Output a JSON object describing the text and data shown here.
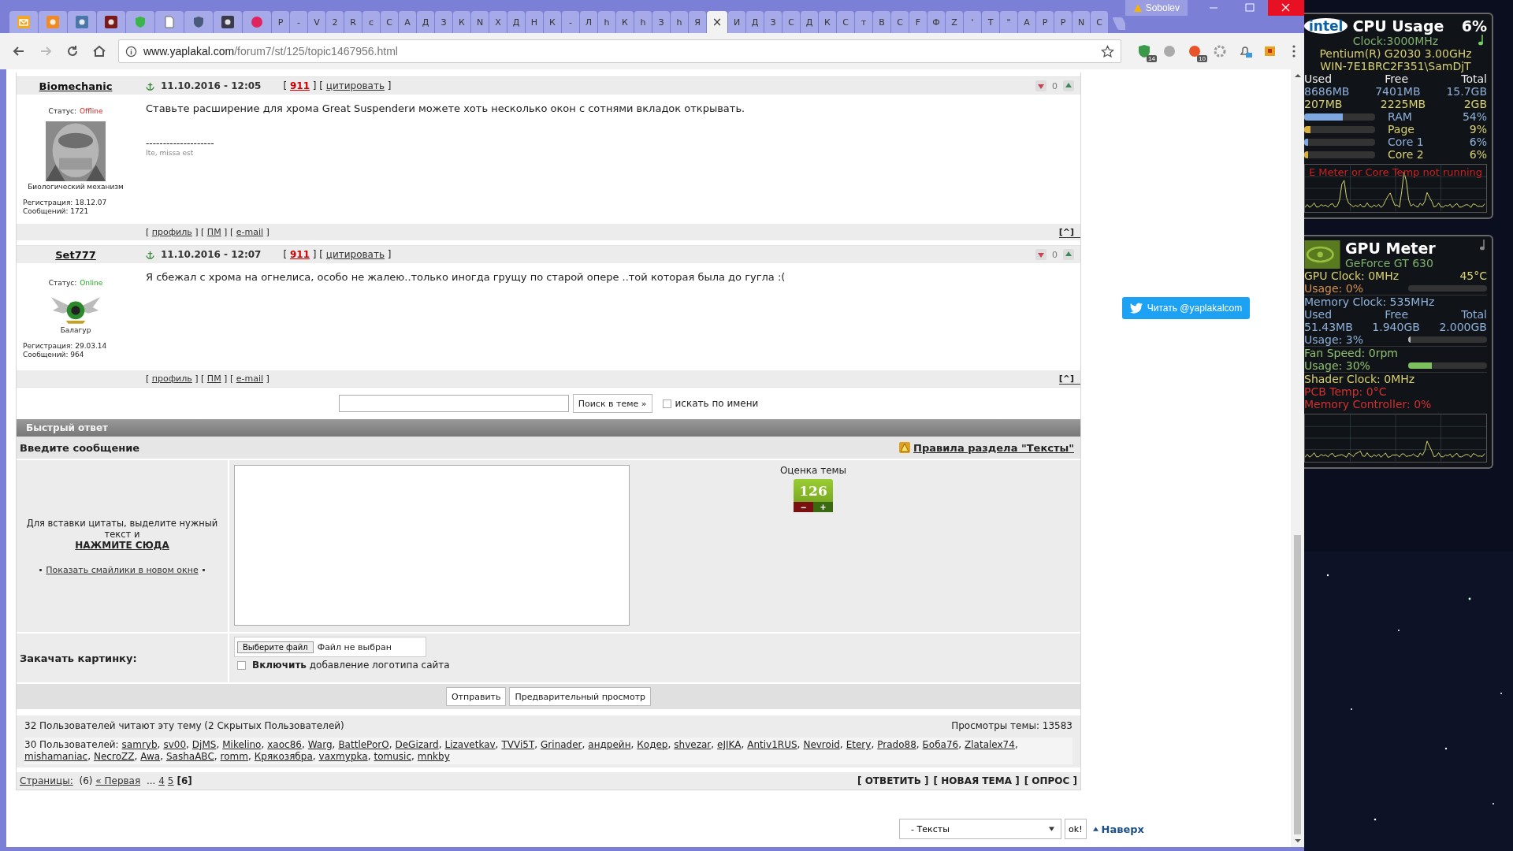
{
  "browser": {
    "profile": "Sobolev",
    "tabs": [
      {
        "kind": "favicon",
        "selected": false
      },
      {
        "kind": "favicon",
        "selected": false
      },
      {
        "kind": "favicon",
        "selected": false
      },
      {
        "kind": "favicon",
        "selected": false
      },
      {
        "kind": "favicon",
        "selected": false
      },
      {
        "kind": "favicon",
        "selected": false
      },
      {
        "kind": "favicon",
        "selected": false
      },
      {
        "kind": "favicon",
        "selected": false
      },
      {
        "kind": "favicon",
        "selected": false
      },
      {
        "kind": "letter",
        "label": "Р",
        "selected": false
      },
      {
        "kind": "letter",
        "label": "-",
        "selected": false
      },
      {
        "kind": "letter",
        "label": "V",
        "selected": false
      },
      {
        "kind": "letter",
        "label": "2",
        "selected": false
      },
      {
        "kind": "letter",
        "label": "R",
        "selected": false
      },
      {
        "kind": "letter",
        "label": "с",
        "selected": false
      },
      {
        "kind": "letter",
        "label": "С",
        "selected": false
      },
      {
        "kind": "letter",
        "label": "А",
        "selected": false
      },
      {
        "kind": "letter",
        "label": "Д",
        "selected": false
      },
      {
        "kind": "letter",
        "label": "З",
        "selected": false
      },
      {
        "kind": "letter",
        "label": "К",
        "selected": false
      },
      {
        "kind": "letter",
        "label": "N",
        "selected": false
      },
      {
        "kind": "letter",
        "label": "Х",
        "selected": false
      },
      {
        "kind": "letter",
        "label": "Д",
        "selected": false
      },
      {
        "kind": "letter",
        "label": "Н",
        "selected": false
      },
      {
        "kind": "letter",
        "label": "К",
        "selected": false
      },
      {
        "kind": "letter",
        "label": "-",
        "selected": false
      },
      {
        "kind": "letter",
        "label": "Л",
        "selected": false
      },
      {
        "kind": "letter",
        "label": "h",
        "selected": false
      },
      {
        "kind": "letter",
        "label": "К",
        "selected": false
      },
      {
        "kind": "letter",
        "label": "h",
        "selected": false
      },
      {
        "kind": "letter",
        "label": "З",
        "selected": false
      },
      {
        "kind": "letter",
        "label": "h",
        "selected": false
      },
      {
        "kind": "letter",
        "label": "Я",
        "selected": false
      },
      {
        "kind": "letter",
        "label": "×",
        "selected": true
      },
      {
        "kind": "letter",
        "label": "И",
        "selected": false
      },
      {
        "kind": "letter",
        "label": "Д",
        "selected": false
      },
      {
        "kind": "letter",
        "label": "З",
        "selected": false
      },
      {
        "kind": "letter",
        "label": "С",
        "selected": false
      },
      {
        "kind": "letter",
        "label": "Д",
        "selected": false
      },
      {
        "kind": "letter",
        "label": "К",
        "selected": false
      },
      {
        "kind": "letter",
        "label": "С",
        "selected": false
      },
      {
        "kind": "letter",
        "label": "т",
        "selected": false
      },
      {
        "kind": "letter",
        "label": "В",
        "selected": false
      },
      {
        "kind": "letter",
        "label": "С",
        "selected": false
      },
      {
        "kind": "letter",
        "label": "F",
        "selected": false
      },
      {
        "kind": "letter",
        "label": "Ф",
        "selected": false
      },
      {
        "kind": "letter",
        "label": "Z",
        "selected": false
      },
      {
        "kind": "letter",
        "label": "'",
        "selected": false
      },
      {
        "kind": "letter",
        "label": "Т",
        "selected": false
      },
      {
        "kind": "letter",
        "label": "\"",
        "selected": false
      },
      {
        "kind": "letter",
        "label": "А",
        "selected": false
      },
      {
        "kind": "letter",
        "label": "Р",
        "selected": false
      },
      {
        "kind": "letter",
        "label": "Р",
        "selected": false
      },
      {
        "kind": "letter",
        "label": "N",
        "selected": false
      },
      {
        "kind": "letter",
        "label": "С",
        "selected": false
      }
    ],
    "url_host": "www.yaplakal.com",
    "url_path": "/forum7/st/125/topic1467956.html",
    "badges": [
      "14",
      "10"
    ]
  },
  "posts": [
    {
      "author": "Biomechanic",
      "status_label": "Статус:",
      "status": "Offline",
      "online": false,
      "rank": "Биологический механизм",
      "registered": "Регистрация: 18.12.07",
      "messages": "Сообщений: 1721",
      "date": "11.10.2016 - 12:05",
      "votes": "0",
      "text": "Ставьте расширение для хрома Great Suspenderи можете хоть несколько окон с сотнями вкладок открывать.",
      "signature": [
        "--------------------",
        "Ite, missa est"
      ],
      "meta": [
        {
          "kind": "text",
          "text": "[ "
        },
        {
          "kind": "alert",
          "text": "911"
        },
        {
          "kind": "text",
          "text": " ] [ "
        },
        {
          "kind": "link",
          "text": "цитировать"
        },
        {
          "kind": "text",
          "text": " ]"
        }
      ],
      "footer": [
        {
          "kind": "text",
          "text": "[ "
        },
        {
          "kind": "link",
          "text": "профиль"
        },
        {
          "kind": "text",
          "text": " ] [ "
        },
        {
          "kind": "link",
          "text": "ПМ"
        },
        {
          "kind": "text",
          "text": " ] [ "
        },
        {
          "kind": "link",
          "text": "e-mail"
        },
        {
          "kind": "text",
          "text": " ]"
        }
      ],
      "top": "[^]"
    },
    {
      "author": "Set777",
      "status_label": "Статус:",
      "status": "Online",
      "online": true,
      "rank": "Балагур",
      "registered": "Регистрация: 29.03.14",
      "messages": "Сообщений: 964",
      "date": "11.10.2016 - 12:07",
      "votes": "0",
      "text": "Я сбежал с хрома на огнелиса, особо не жалею..только иногда грущу по старой опере ..той которая была до гугла :(",
      "meta": [
        {
          "kind": "text",
          "text": "[ "
        },
        {
          "kind": "alert",
          "text": "911"
        },
        {
          "kind": "text",
          "text": " ] [ "
        },
        {
          "kind": "link",
          "text": "цитировать"
        },
        {
          "kind": "text",
          "text": " ]"
        }
      ],
      "footer": [
        {
          "kind": "text",
          "text": "[ "
        },
        {
          "kind": "link",
          "text": "профиль"
        },
        {
          "kind": "text",
          "text": " ] [ "
        },
        {
          "kind": "link",
          "text": "ПМ"
        },
        {
          "kind": "text",
          "text": " ] [ "
        },
        {
          "kind": "link",
          "text": "e-mail"
        },
        {
          "kind": "text",
          "text": " ]"
        }
      ],
      "top": "[^]"
    }
  ],
  "search": {
    "button": "Поиск в теме »",
    "checkbox_label": "искать по имени",
    "checked": false
  },
  "quick_reply": {
    "title": "Быстрый ответ",
    "prompt": "Введите сообщение",
    "rules": "Правила раздела \"Тексты\"",
    "hint": "Для вставки цитаты, выделите нужный текст и",
    "hint_link": "НАЖМИТЕ СЮДА",
    "smileys": [
      {
        "kind": "text",
        "text": "• "
      },
      {
        "kind": "link",
        "text": "Показать смайлики в новом окне"
      },
      {
        "kind": "text",
        "text": " •"
      }
    ],
    "rating_label": "Оценка темы",
    "rating": "126",
    "minus": "−",
    "plus": "+",
    "upload_label": "Закачать картинку:",
    "file_button": "Выберите файл",
    "file_status": "Файл не выбран",
    "logo_checked": false,
    "logo_label": "**Включить** добавление логотипа сайта",
    "buttons": [
      "Отправить",
      "Предварительный просмотр"
    ]
  },
  "readers": {
    "summary": "32 Пользователей читают эту тему (2 Скрытых Пользователей)",
    "views": "Просмотры темы: 13583",
    "prefix": "30 Пользователей:",
    "users": [
      {
        "name": "samryb",
        "sep": ","
      },
      {
        "name": "sv00",
        "sep": ","
      },
      {
        "name": "DjMS",
        "sep": ","
      },
      {
        "name": "Mikelino",
        "sep": ","
      },
      {
        "name": "xaoc86",
        "sep": ","
      },
      {
        "name": "Warg",
        "sep": ","
      },
      {
        "name": "BattlePorO",
        "sep": ","
      },
      {
        "name": "DeGizard",
        "sep": ","
      },
      {
        "name": "Lizavetkav",
        "sep": ","
      },
      {
        "name": "TVVi5T",
        "sep": ","
      },
      {
        "name": "Grinader",
        "sep": ","
      },
      {
        "name": "андрейн",
        "sep": ","
      },
      {
        "name": "Кодер",
        "sep": ","
      },
      {
        "name": "shvezar",
        "sep": ","
      },
      {
        "name": "eJIKA",
        "sep": ","
      },
      {
        "name": "Antiv1RUS",
        "sep": ","
      },
      {
        "name": "Nevroid",
        "sep": ","
      },
      {
        "name": "Etery",
        "sep": ","
      },
      {
        "name": "Prado88",
        "sep": ","
      },
      {
        "name": "Боба76",
        "sep": ","
      },
      {
        "name": "Zlatalex74",
        "sep": ","
      },
      {
        "name": "mishamaniac",
        "sep": ","
      },
      {
        "name": "NecroZZ",
        "sep": ","
      },
      {
        "name": "Awa",
        "sep": ","
      },
      {
        "name": "SashaABC",
        "sep": ","
      },
      {
        "name": "romm",
        "sep": ","
      },
      {
        "name": "Крякозябра",
        "sep": ","
      },
      {
        "name": "vaxmypka",
        "sep": ","
      },
      {
        "name": "tomusic",
        "sep": ","
      },
      {
        "name": "mnkby"
      }
    ]
  },
  "pages": {
    "segments": [
      {
        "kind": "link",
        "text": "Страницы:"
      },
      {
        "kind": "text",
        "text": " (6) "
      },
      {
        "kind": "link",
        "text": "« Первая"
      },
      {
        "kind": "text",
        "text": " ... "
      },
      {
        "kind": "link",
        "text": "4"
      },
      {
        "kind": "link",
        "text": "5"
      },
      {
        "kind": "bold",
        "text": "[6]"
      }
    ],
    "actions": [
      "[ ОТВЕТИТЬ ]",
      "[ НОВАЯ ТЕМА ]",
      "[ ОПРОС ]"
    ]
  },
  "footer": {
    "section": "- Тексты",
    "ok": "ok!",
    "top": "Наверх"
  },
  "twitter": {
    "label": "Читать @yaplakalcom"
  },
  "cpu_gadget": {
    "logo": "intel",
    "title": "CPU Usage",
    "percent": "6%",
    "clock": "Clock:3000MHz",
    "model": "Pentium(R) G2030 3.00GHz",
    "host": "WIN-7E1BRC2F351\\SamDjT",
    "columns": [
      "Used",
      "Free",
      "Total"
    ],
    "rows": [
      [
        "8686MB",
        "7401MB",
        "15.7GB"
      ],
      [
        "207MB",
        "2225MB",
        "2GB"
      ]
    ],
    "meters": [
      {
        "label": "RAM",
        "value": "54%",
        "level": 0.54
      },
      {
        "label": "Page",
        "value": "9%",
        "level": 0.09
      },
      {
        "label": "Core 1",
        "value": "6%",
        "level": 0.06
      },
      {
        "label": "Core 2",
        "value": "6%",
        "level": 0.06
      }
    ],
    "warning": "E Meter or Core Temp not running"
  },
  "gpu_gadget": {
    "title": "GPU Meter",
    "card": "GeForce GT 630",
    "clock": "GPU Clock: 0MHz",
    "temp": "45°C",
    "gpu_usage": {
      "label": "Usage: 0%"
    },
    "mem_clock": "Memory Clock: 535MHz",
    "columns": [
      "Used",
      "Free",
      "Total"
    ],
    "mem_row": [
      "51.43MB",
      "1.940GB",
      "2.000GB"
    ],
    "mem_usage": {
      "label": "Usage: 3%",
      "level": 0.03
    },
    "fan": "Fan Speed: 0rpm",
    "fan_usage": {
      "label": "Usage: 30%",
      "level": 0.3
    },
    "shader": "Shader Clock: 0MHz",
    "pcb": "PCB Temp: 0°C",
    "mem_ctrl": "Memory Controller: 0%"
  }
}
